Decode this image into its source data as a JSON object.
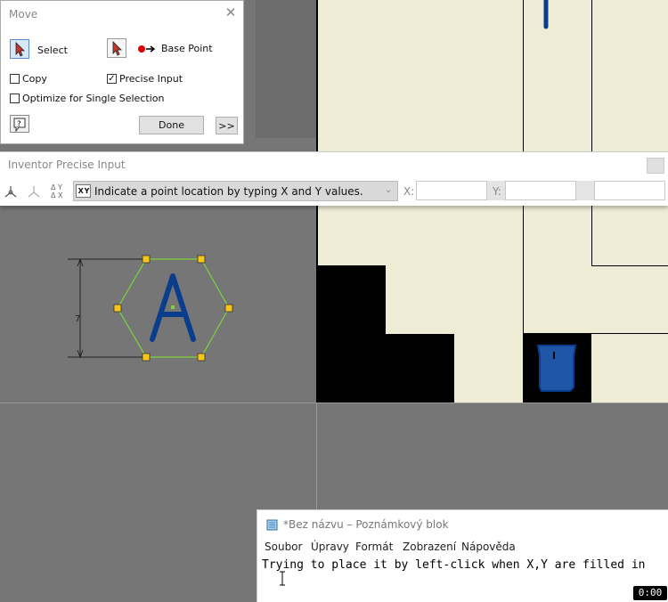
{
  "move_dialog": {
    "title": "Move",
    "select_label": "Select",
    "base_point_label": "Base Point",
    "copy_label": "Copy",
    "precise_input_label": "Precise Input",
    "optimize_label": "Optimize for Single Selection",
    "done_label": "Done",
    "more_label": ">>",
    "copy_checked": false,
    "precise_checked": true,
    "optimize_checked": false
  },
  "precise_input": {
    "title": "Inventor Precise Input",
    "mode_badge": "X Y",
    "mode_text": "Indicate a point location by typing X and Y values.",
    "x_label": "X:",
    "y_label": "Y:",
    "x_value": "",
    "y_value": "",
    "z_value": ""
  },
  "canvas": {
    "letter_a": "A",
    "dim_value": "7",
    "accent_blue": "#0a3d8c",
    "sketch_green": "#7cd43a",
    "grip_yellow": "#f5c518"
  },
  "notepad": {
    "title": "*Bez názvu – Poznámkový blok",
    "menu": [
      "Soubor",
      "Úpravy",
      "Formát",
      "Zobrazení",
      "Nápověda"
    ],
    "text": "Trying to place it by left-click when X,Y are filled in"
  },
  "timer": "0:00"
}
